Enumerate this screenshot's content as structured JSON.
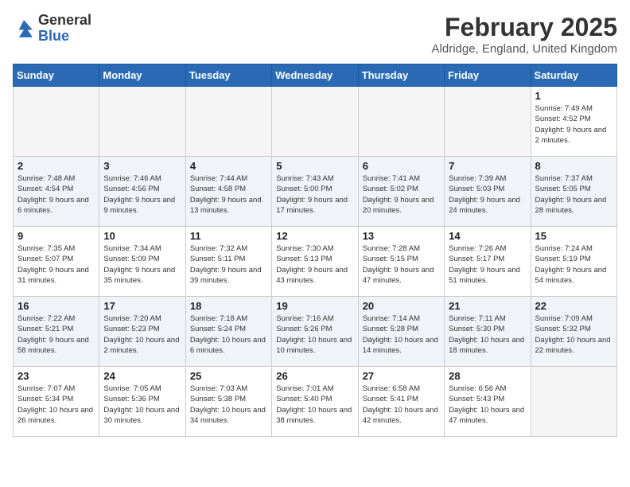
{
  "header": {
    "logo": {
      "general": "General",
      "blue": "Blue"
    },
    "title": "February 2025",
    "subtitle": "Aldridge, England, United Kingdom"
  },
  "weekdays": [
    "Sunday",
    "Monday",
    "Tuesday",
    "Wednesday",
    "Thursday",
    "Friday",
    "Saturday"
  ],
  "weeks": [
    [
      {
        "day": "",
        "info": ""
      },
      {
        "day": "",
        "info": ""
      },
      {
        "day": "",
        "info": ""
      },
      {
        "day": "",
        "info": ""
      },
      {
        "day": "",
        "info": ""
      },
      {
        "day": "",
        "info": ""
      },
      {
        "day": "1",
        "info": "Sunrise: 7:49 AM\nSunset: 4:52 PM\nDaylight: 9 hours and 2 minutes."
      }
    ],
    [
      {
        "day": "2",
        "info": "Sunrise: 7:48 AM\nSunset: 4:54 PM\nDaylight: 9 hours and 6 minutes."
      },
      {
        "day": "3",
        "info": "Sunrise: 7:46 AM\nSunset: 4:56 PM\nDaylight: 9 hours and 9 minutes."
      },
      {
        "day": "4",
        "info": "Sunrise: 7:44 AM\nSunset: 4:58 PM\nDaylight: 9 hours and 13 minutes."
      },
      {
        "day": "5",
        "info": "Sunrise: 7:43 AM\nSunset: 5:00 PM\nDaylight: 9 hours and 17 minutes."
      },
      {
        "day": "6",
        "info": "Sunrise: 7:41 AM\nSunset: 5:02 PM\nDaylight: 9 hours and 20 minutes."
      },
      {
        "day": "7",
        "info": "Sunrise: 7:39 AM\nSunset: 5:03 PM\nDaylight: 9 hours and 24 minutes."
      },
      {
        "day": "8",
        "info": "Sunrise: 7:37 AM\nSunset: 5:05 PM\nDaylight: 9 hours and 28 minutes."
      }
    ],
    [
      {
        "day": "9",
        "info": "Sunrise: 7:35 AM\nSunset: 5:07 PM\nDaylight: 9 hours and 31 minutes."
      },
      {
        "day": "10",
        "info": "Sunrise: 7:34 AM\nSunset: 5:09 PM\nDaylight: 9 hours and 35 minutes."
      },
      {
        "day": "11",
        "info": "Sunrise: 7:32 AM\nSunset: 5:11 PM\nDaylight: 9 hours and 39 minutes."
      },
      {
        "day": "12",
        "info": "Sunrise: 7:30 AM\nSunset: 5:13 PM\nDaylight: 9 hours and 43 minutes."
      },
      {
        "day": "13",
        "info": "Sunrise: 7:28 AM\nSunset: 5:15 PM\nDaylight: 9 hours and 47 minutes."
      },
      {
        "day": "14",
        "info": "Sunrise: 7:26 AM\nSunset: 5:17 PM\nDaylight: 9 hours and 51 minutes."
      },
      {
        "day": "15",
        "info": "Sunrise: 7:24 AM\nSunset: 5:19 PM\nDaylight: 9 hours and 54 minutes."
      }
    ],
    [
      {
        "day": "16",
        "info": "Sunrise: 7:22 AM\nSunset: 5:21 PM\nDaylight: 9 hours and 58 minutes."
      },
      {
        "day": "17",
        "info": "Sunrise: 7:20 AM\nSunset: 5:23 PM\nDaylight: 10 hours and 2 minutes."
      },
      {
        "day": "18",
        "info": "Sunrise: 7:18 AM\nSunset: 5:24 PM\nDaylight: 10 hours and 6 minutes."
      },
      {
        "day": "19",
        "info": "Sunrise: 7:16 AM\nSunset: 5:26 PM\nDaylight: 10 hours and 10 minutes."
      },
      {
        "day": "20",
        "info": "Sunrise: 7:14 AM\nSunset: 5:28 PM\nDaylight: 10 hours and 14 minutes."
      },
      {
        "day": "21",
        "info": "Sunrise: 7:11 AM\nSunset: 5:30 PM\nDaylight: 10 hours and 18 minutes."
      },
      {
        "day": "22",
        "info": "Sunrise: 7:09 AM\nSunset: 5:32 PM\nDaylight: 10 hours and 22 minutes."
      }
    ],
    [
      {
        "day": "23",
        "info": "Sunrise: 7:07 AM\nSunset: 5:34 PM\nDaylight: 10 hours and 26 minutes."
      },
      {
        "day": "24",
        "info": "Sunrise: 7:05 AM\nSunset: 5:36 PM\nDaylight: 10 hours and 30 minutes."
      },
      {
        "day": "25",
        "info": "Sunrise: 7:03 AM\nSunset: 5:38 PM\nDaylight: 10 hours and 34 minutes."
      },
      {
        "day": "26",
        "info": "Sunrise: 7:01 AM\nSunset: 5:40 PM\nDaylight: 10 hours and 38 minutes."
      },
      {
        "day": "27",
        "info": "Sunrise: 6:58 AM\nSunset: 5:41 PM\nDaylight: 10 hours and 42 minutes."
      },
      {
        "day": "28",
        "info": "Sunrise: 6:56 AM\nSunset: 5:43 PM\nDaylight: 10 hours and 47 minutes."
      },
      {
        "day": "",
        "info": ""
      }
    ]
  ]
}
